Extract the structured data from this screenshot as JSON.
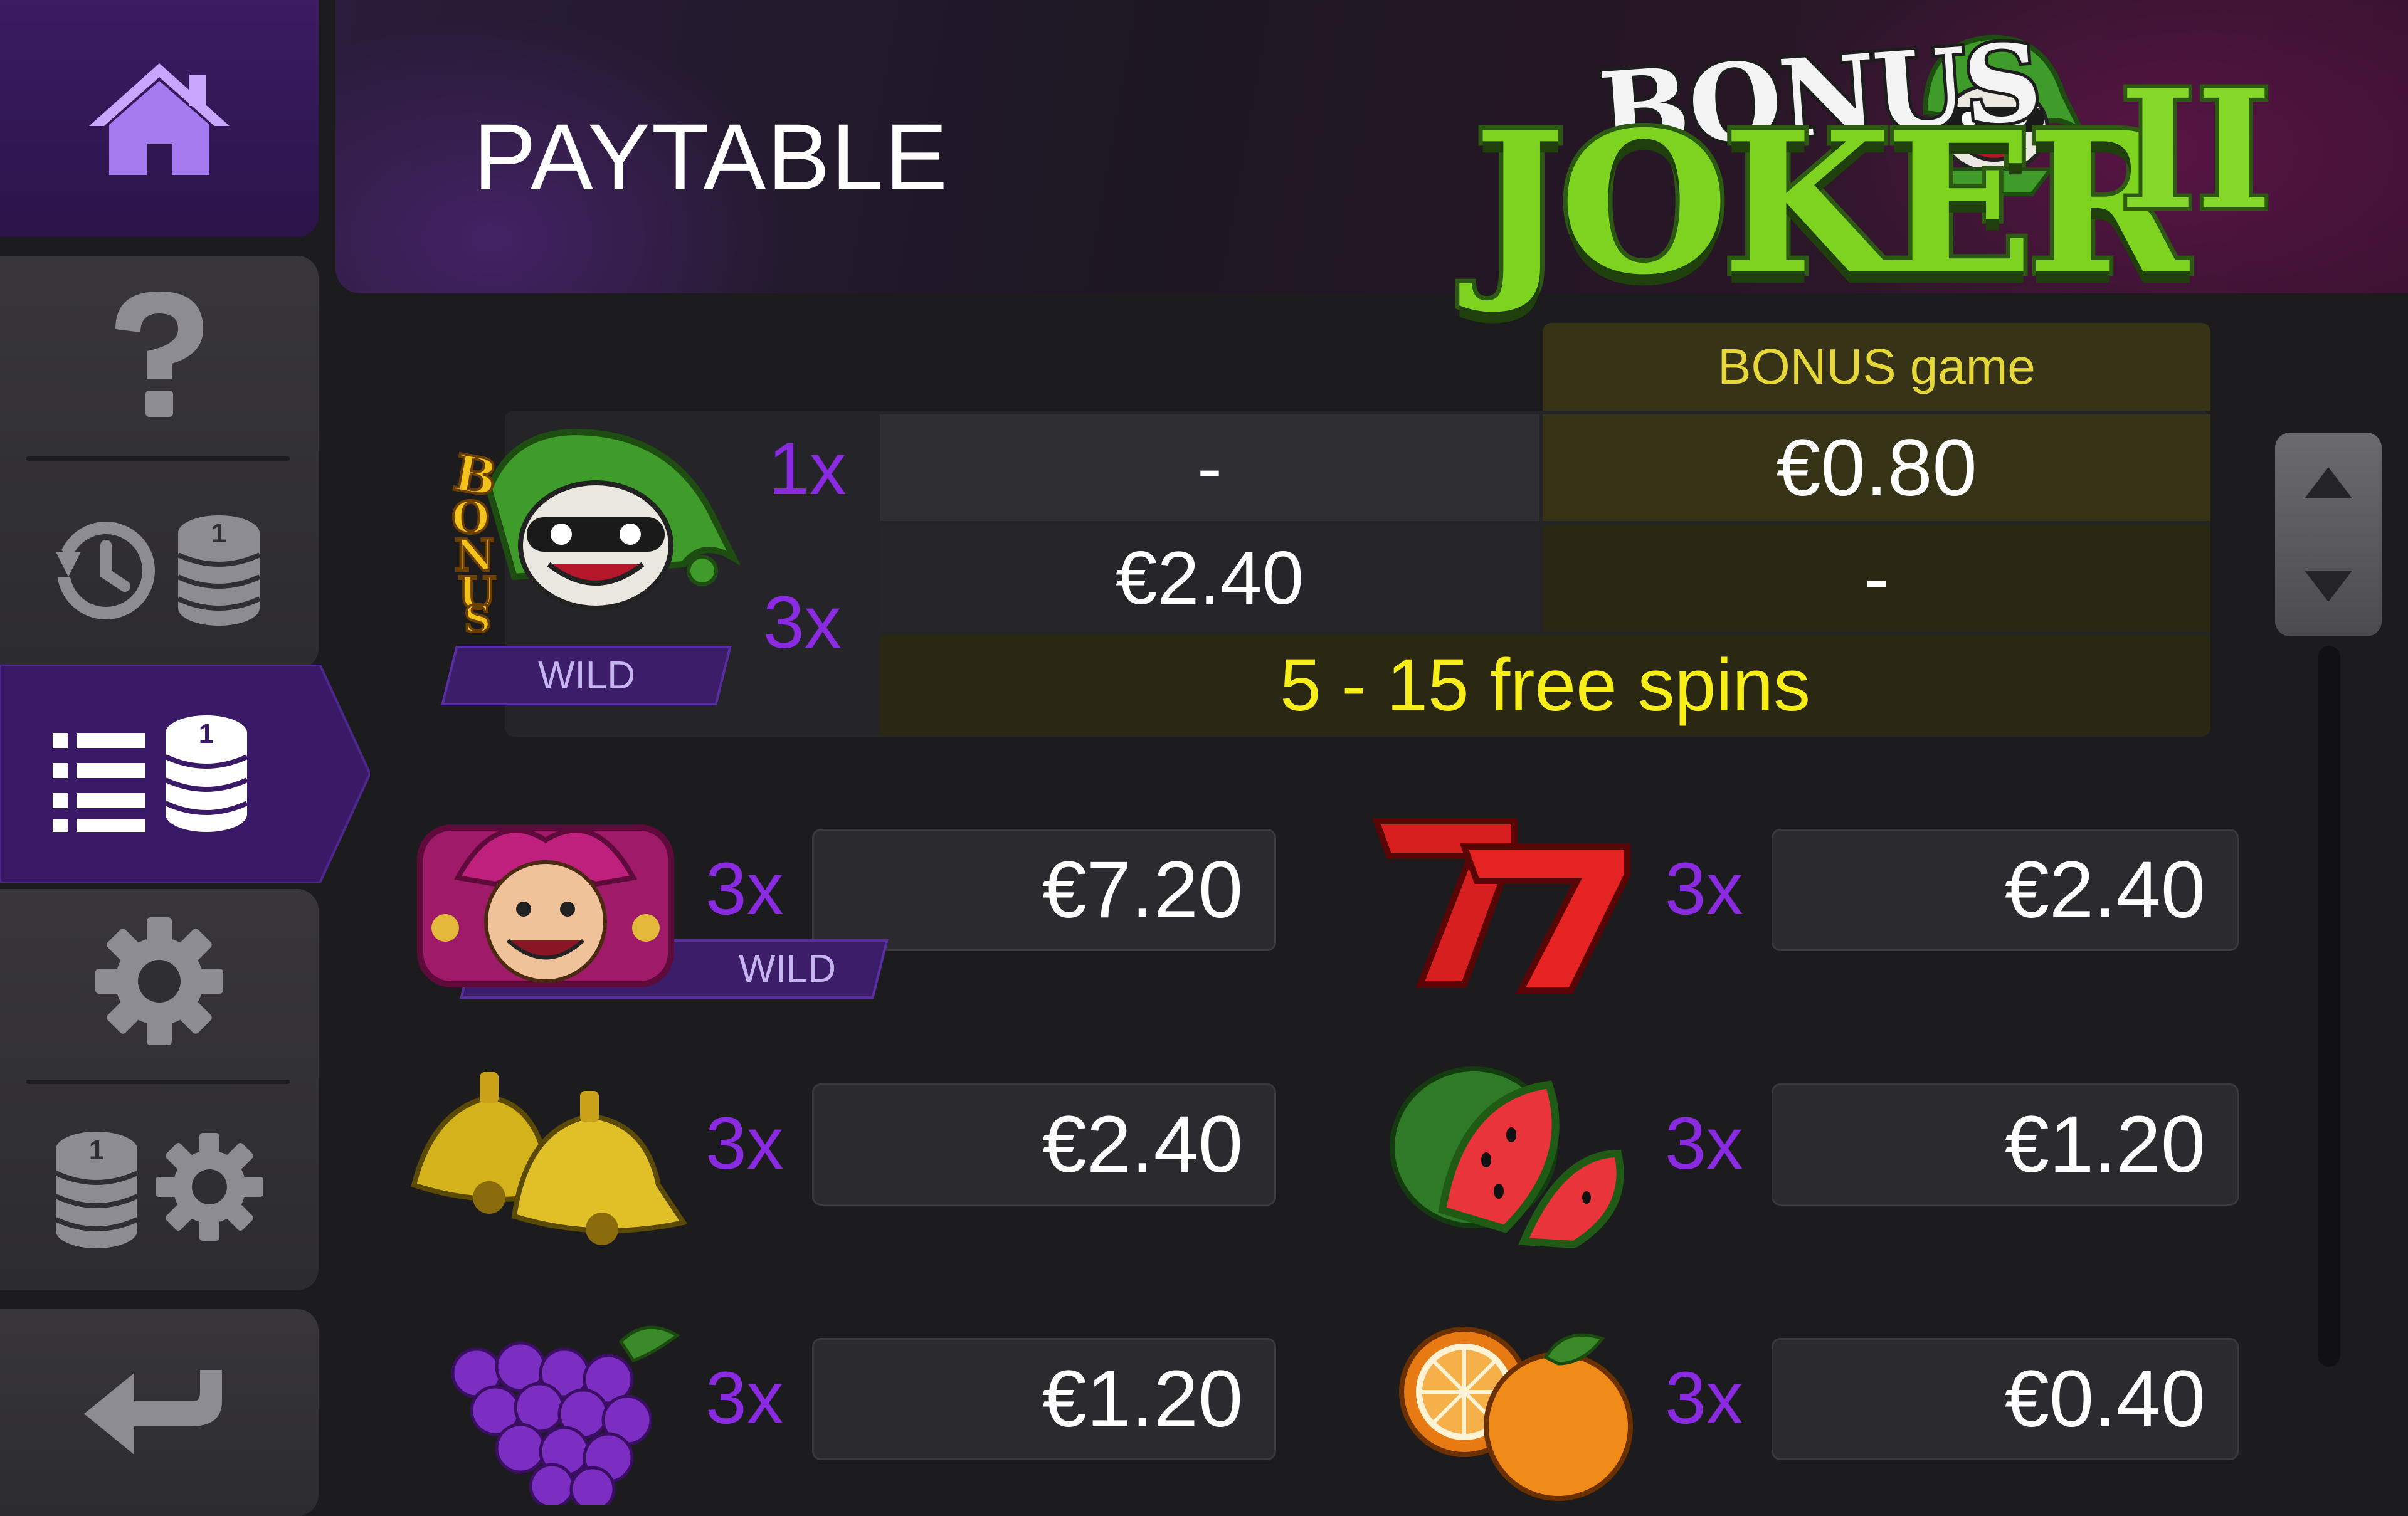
{
  "header": {
    "title": "PAYTABLE",
    "logo": {
      "line1": "BONUS",
      "line2": "JOKER",
      "line3": "II"
    }
  },
  "sidebar": {
    "items": [
      {
        "name": "home",
        "icon": "home-icon",
        "active": false
      },
      {
        "name": "help",
        "icon": "question-icon",
        "active": false
      },
      {
        "name": "history",
        "icon": "history-coins-icon",
        "active": false
      },
      {
        "name": "paytable",
        "icon": "list-coins-icon",
        "active": true
      },
      {
        "name": "settings",
        "icon": "gear-icon",
        "active": false
      },
      {
        "name": "bet-settings",
        "icon": "coins-gear-icon",
        "active": false
      },
      {
        "name": "back",
        "icon": "back-arrow-icon",
        "active": false
      }
    ]
  },
  "bonus_symbol": {
    "label": "WILD",
    "column_header": "BONUS game",
    "rows": [
      {
        "multiplier": "1x",
        "base": "-",
        "bonus": "€0.80"
      },
      {
        "multiplier": "3x",
        "base": "€2.40",
        "bonus": "-"
      }
    ],
    "free_spins": "5 - 15 free spins"
  },
  "symbols": [
    {
      "symbol": "joker-wild",
      "label": "WILD",
      "multiplier": "3x",
      "value": "€7.20"
    },
    {
      "symbol": "sevens",
      "multiplier": "3x",
      "value": "€2.40"
    },
    {
      "symbol": "bells",
      "multiplier": "3x",
      "value": "€2.40"
    },
    {
      "symbol": "watermelon",
      "multiplier": "3x",
      "value": "€1.20"
    },
    {
      "symbol": "grapes",
      "multiplier": "3x",
      "value": "€1.20"
    },
    {
      "symbol": "oranges",
      "multiplier": "3x",
      "value": "€0.40"
    }
  ],
  "colors": {
    "accent_purple": "#8a2be2",
    "bonus_yellow": "#f7ee1a",
    "sidebar_active": "#3a1a66",
    "background": "#1c1b1e"
  }
}
